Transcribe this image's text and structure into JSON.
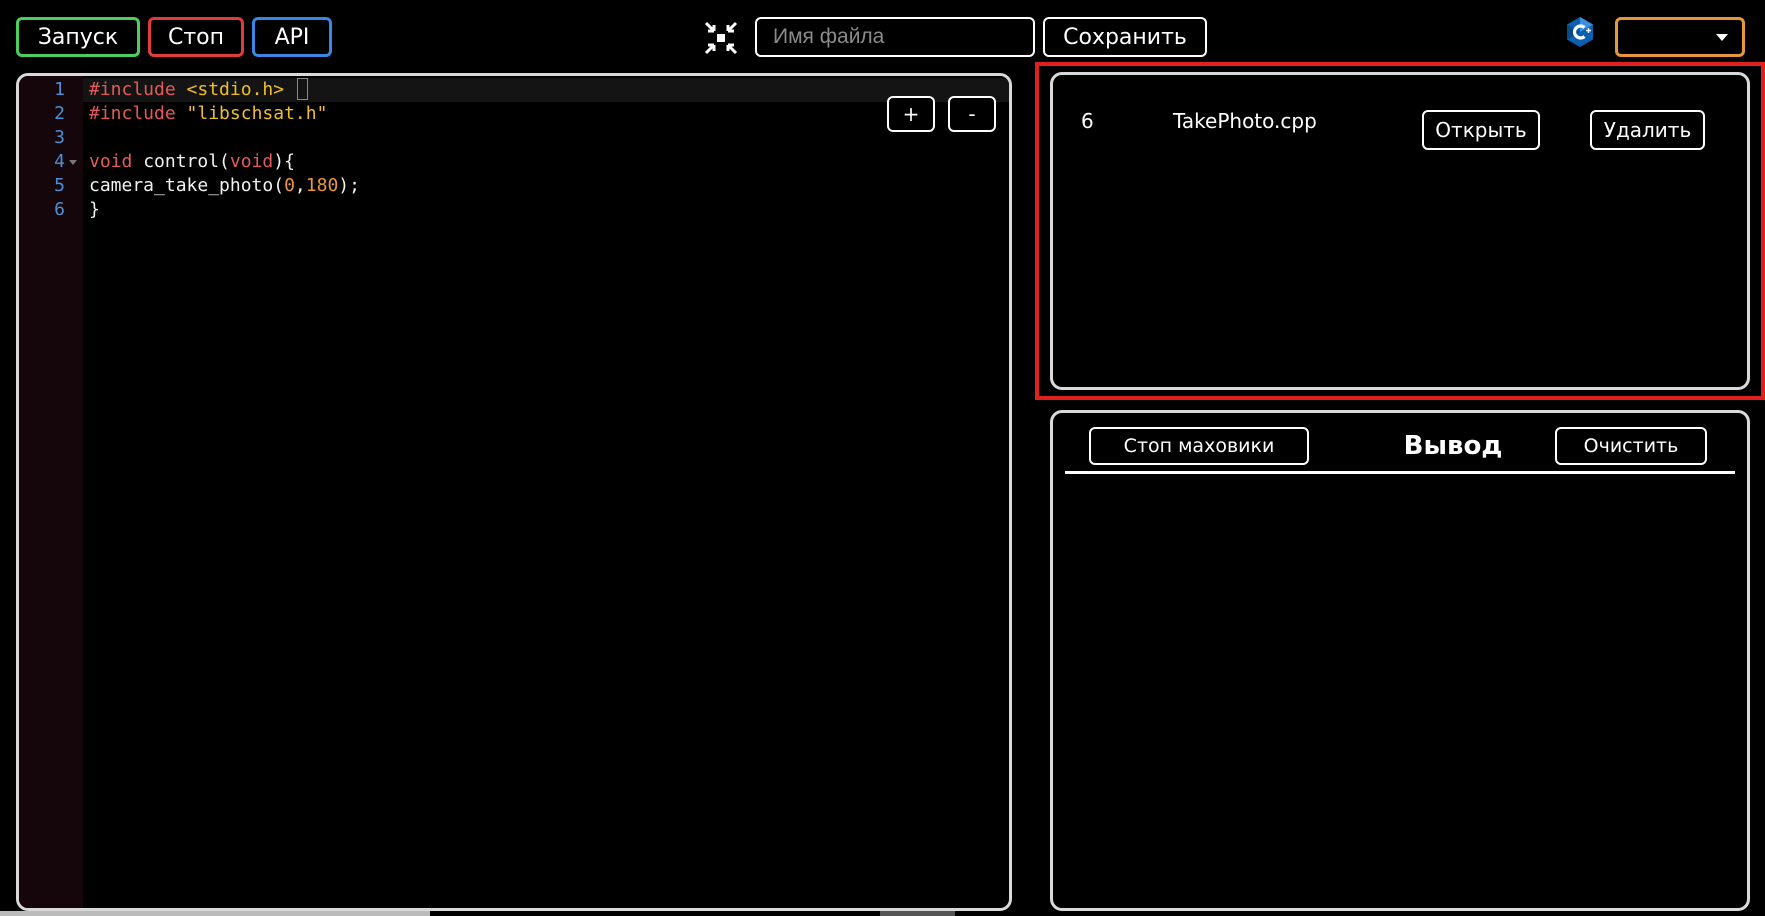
{
  "toolbar": {
    "run_label": "Запуск",
    "stop_label": "Стоп",
    "api_label": "API",
    "filename_placeholder": "Имя файла",
    "save_label": "Сохранить",
    "zoom_in_label": "+",
    "zoom_out_label": "-"
  },
  "icons": {
    "collapse": "collapse-arrows-icon",
    "language": "cpp-logo-icon",
    "dropdown": "chevron-down-icon"
  },
  "colors": {
    "run": "#4ccf5a",
    "stop": "#e23b3b",
    "api": "#3b86e2",
    "language_select": "#e8963a",
    "highlight": "#e02020"
  },
  "language_select": {
    "value": ""
  },
  "editor": {
    "line_numbers": [
      "1",
      "2",
      "3",
      "4",
      "5",
      "6"
    ],
    "lines": [
      "#include <stdio.h>",
      "#include \"libschsat.h\"",
      "",
      "void control(void){",
      "camera_take_photo(0,180);",
      "}"
    ]
  },
  "files": [
    {
      "id": "6",
      "name": "TakePhoto.cpp",
      "open_label": "Открыть",
      "delete_label": "Удалить"
    }
  ],
  "output": {
    "stop_wheels_label": "Стоп маховики",
    "title": "Вывод",
    "clear_label": "Очистить",
    "content": ""
  }
}
